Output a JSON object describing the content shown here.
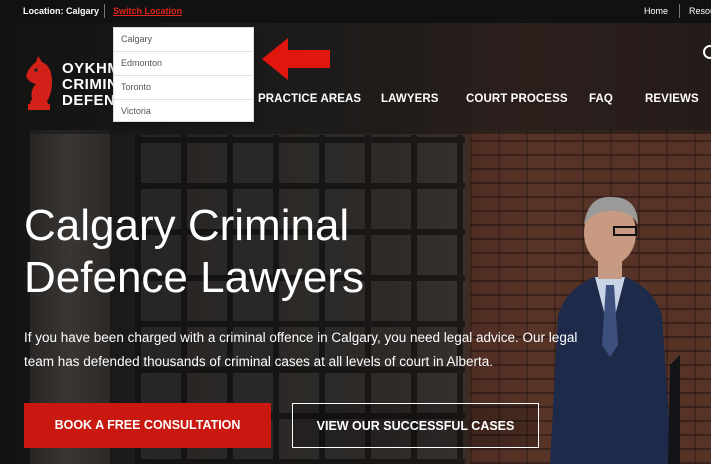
{
  "topbar": {
    "location_label": "Location: Calgary",
    "switch_label": "Switch Location",
    "home_label": "Home",
    "resources_label": "Resou"
  },
  "location_dropdown": {
    "options": [
      "Calgary",
      "Edmonton",
      "Toronto",
      "Victoria"
    ]
  },
  "logo": {
    "lines": [
      "OYKHM",
      "CRIMIN",
      "DEFEN"
    ]
  },
  "nav": {
    "items": [
      "PRACTICE AREAS",
      "LAWYERS",
      "COURT PROCESS",
      "FAQ",
      "REVIEWS"
    ]
  },
  "hero": {
    "headline_line1": "Calgary Criminal",
    "headline_line2": "Defence Lawyers",
    "description": "If you have been charged with a criminal offence in Calgary, you need legal advice. Our legal team has defended thousands of criminal cases at all levels of court in Alberta.",
    "primary_button": "BOOK A FREE CONSULTATION",
    "secondary_button": "VIEW OUR SUCCESSFUL CASES"
  },
  "colors": {
    "accent_red": "#c8180f",
    "link_red": "#e1251b",
    "topbar_bg": "#111111"
  },
  "icons": [
    "chess-knight-logo-icon",
    "search-icon",
    "red-arrow-icon"
  ]
}
